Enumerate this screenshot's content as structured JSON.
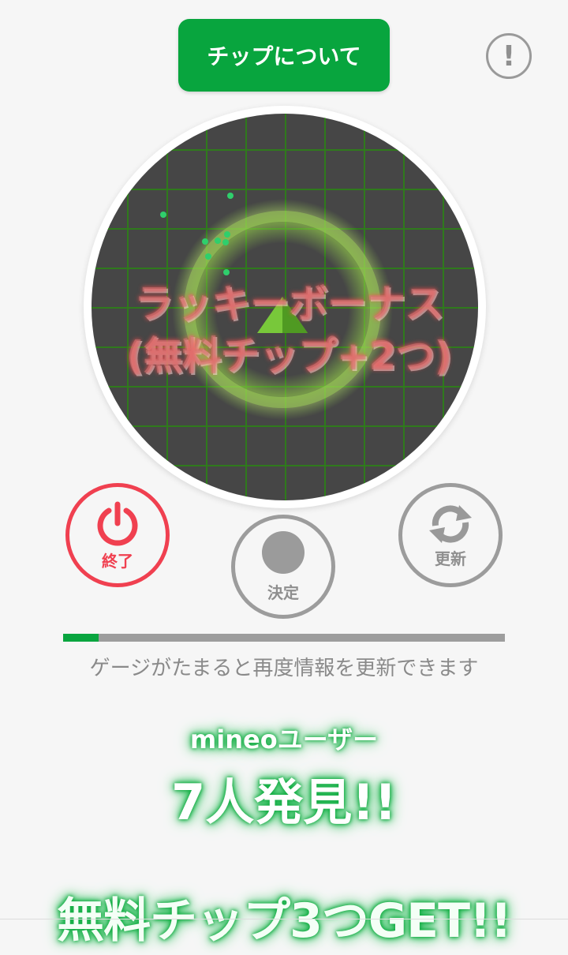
{
  "header": {
    "about_chip_label": "チップについて",
    "info_label": "!"
  },
  "radar": {
    "bonus_line1": "ラッキーボーナス",
    "bonus_line2": "(無料チップ+2つ)"
  },
  "controls": {
    "end_label": "終了",
    "decide_label": "決定",
    "refresh_label": "更新"
  },
  "gauge": {
    "fill_fraction": 0.08,
    "note": "ゲージがたまると再度情報を更新できます"
  },
  "result": {
    "users_label": "mineoユーザー",
    "users_found": "7人発見!!",
    "free_chip": "無料チップ3つGET!!"
  },
  "colors": {
    "accent_green": "#08a53e",
    "end_red": "#f04050",
    "neutral_gray": "#9c9c9c"
  }
}
